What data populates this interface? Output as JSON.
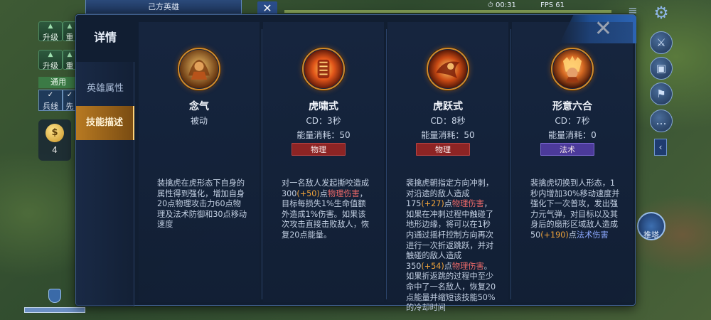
{
  "hud": {
    "team_label": "己方英雄",
    "timer": "00:31",
    "fps": "FPS 61",
    "upgrade_label": "升级",
    "reset_label": "重",
    "apply_label": "通用",
    "troop_label": "兵线",
    "first_label": "先",
    "gold_symbol": "$",
    "gold_count": "4",
    "recall_label": "推塔"
  },
  "dialog": {
    "title": "详情",
    "nav": [
      {
        "label": "英雄属性",
        "active": false
      },
      {
        "label": "技能描述",
        "active": true
      }
    ],
    "close_symbol": "✕"
  },
  "skills": [
    {
      "name": "念气",
      "line1": "被动",
      "line2": "",
      "tag": "",
      "tag_type": "",
      "desc": [
        {
          "t": "装擒虎在虎形态下自身的属性得到强化，增加自身20点物理攻击力60点物理及法术防御和30点移动速度",
          "c": ""
        }
      ]
    },
    {
      "name": "虎啸式",
      "line1": "CD：3秒",
      "line2": "能量消耗：50",
      "tag": "物理",
      "tag_type": "phys",
      "desc": [
        {
          "t": "对一名敌人发起撕咬造成300",
          "c": ""
        },
        {
          "t": "(+50)",
          "c": "num"
        },
        {
          "t": "点",
          "c": ""
        },
        {
          "t": "物理伤害",
          "c": "dmg-p"
        },
        {
          "t": "，目标每损失1%生命值额外造成1%伤害。如果该次攻击直接击败敌人，恢复20点能量。",
          "c": ""
        }
      ]
    },
    {
      "name": "虎跃式",
      "line1": "CD：8秒",
      "line2": "能量消耗：50",
      "tag": "物理",
      "tag_type": "phys",
      "desc": [
        {
          "t": "裴擒虎朝指定方向冲刺，对沿途的敌人造成175",
          "c": ""
        },
        {
          "t": "(+27)",
          "c": "num"
        },
        {
          "t": "点",
          "c": ""
        },
        {
          "t": "物理伤害",
          "c": "dmg-p"
        },
        {
          "t": "，如果在冲刺过程中触碰了地形边缘，将可以在1秒内通过摇杆控制方向再次进行一次折返跳跃，并对触碰的敌人造成350",
          "c": ""
        },
        {
          "t": "(+54)",
          "c": "num"
        },
        {
          "t": "点",
          "c": ""
        },
        {
          "t": "物理伤害",
          "c": "dmg-p"
        },
        {
          "t": "。如果折返跳的过程中至少命中了一名敌人，恢复20点能量并缩短该技能50%的冷却时间",
          "c": ""
        }
      ]
    },
    {
      "name": "形意六合",
      "line1": "CD：7秒",
      "line2": "能量消耗：0",
      "tag": "法术",
      "tag_type": "magic",
      "desc": [
        {
          "t": "裴擒虎切换到人形态，1秒内增加30%移动速度并强化下一次普攻，发出强力元气弹，对目标以及其身后的扇形区域敌人造成50",
          "c": ""
        },
        {
          "t": "(+190)",
          "c": "num"
        },
        {
          "t": "点",
          "c": ""
        },
        {
          "t": "法术伤害",
          "c": "dmg-m"
        }
      ]
    }
  ]
}
